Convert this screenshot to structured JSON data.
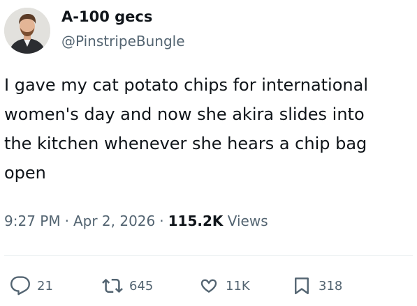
{
  "author": {
    "display_name": "A-100 gecs",
    "handle": "@PinstripeBungle"
  },
  "tweet": {
    "text": "I gave my cat potato chips for international\nwomen's day and now she akira slides into\nthe kitchen whenever she hears a chip bag\nopen",
    "time": "9:27 PM",
    "date": "Apr 2, 2026",
    "separator": "·",
    "views_count": "115.2K",
    "views_label": "Views"
  },
  "actions": {
    "replies": "21",
    "reposts": "645",
    "likes": "11K",
    "bookmarks": "318"
  },
  "icons": {
    "reply": "speech-bubble-icon",
    "repost": "repost-arrows-icon",
    "like": "heart-icon",
    "bookmark": "bookmark-icon"
  },
  "colors": {
    "text_primary": "#0f1419",
    "text_secondary": "#536471",
    "divider": "#eff3f4"
  }
}
